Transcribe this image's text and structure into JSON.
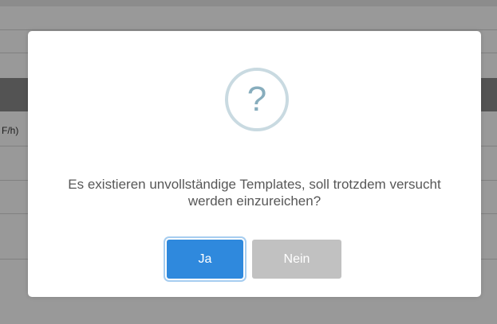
{
  "background": {
    "column_fragment": "F/h)"
  },
  "dialog": {
    "icon": "question-mark-icon",
    "icon_glyph": "?",
    "message": "Es existieren unvollständige Templates, soll trotzdem versucht werden einzureichen?",
    "confirm_label": "Ja",
    "cancel_label": "Nein"
  },
  "colors": {
    "confirm_button": "#2f89dd",
    "cancel_button": "#c1c1c1",
    "icon_ring": "#c9dae1",
    "icon_glyph": "#87adbd",
    "message_text": "#575757"
  }
}
